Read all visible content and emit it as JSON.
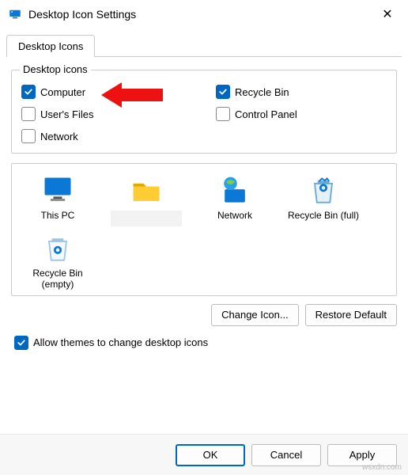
{
  "window": {
    "title": "Desktop Icon Settings",
    "close_label": "✕"
  },
  "tab": {
    "label": "Desktop Icons"
  },
  "group": {
    "legend": "Desktop icons",
    "items": [
      {
        "label": "Computer",
        "checked": true
      },
      {
        "label": "Recycle Bin",
        "checked": true
      },
      {
        "label": "User's Files",
        "checked": false
      },
      {
        "label": "Control Panel",
        "checked": false
      },
      {
        "label": "Network",
        "checked": false
      }
    ]
  },
  "preview": {
    "icons": [
      {
        "label": "This PC",
        "kind": "monitor"
      },
      {
        "label": "",
        "kind": "folder",
        "blank": true
      },
      {
        "label": "Network",
        "kind": "network"
      },
      {
        "label": "Recycle Bin (full)",
        "kind": "bin-full"
      },
      {
        "label": "Recycle Bin (empty)",
        "kind": "bin-empty"
      }
    ]
  },
  "buttons": {
    "change_icon": "Change Icon...",
    "restore_default": "Restore Default",
    "ok": "OK",
    "cancel": "Cancel",
    "apply": "Apply"
  },
  "allow_themes": {
    "label": "Allow themes to change desktop icons",
    "checked": true
  },
  "watermark": "wsxdn.com"
}
